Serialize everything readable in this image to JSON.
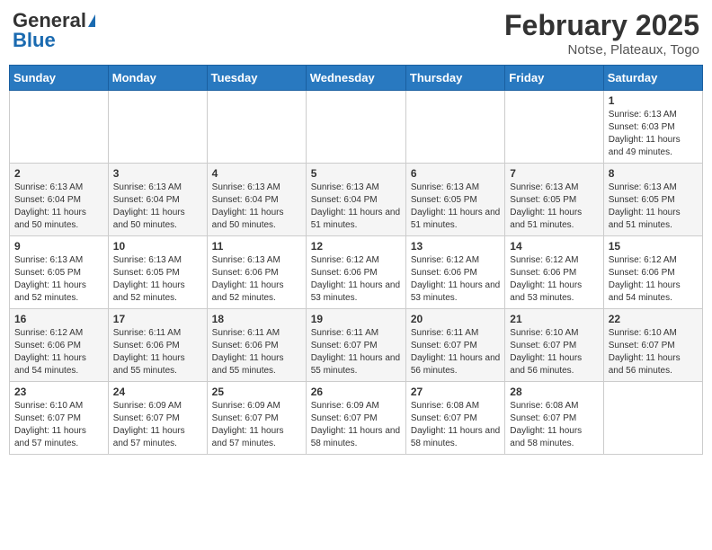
{
  "header": {
    "logo": {
      "line1": "General",
      "line2": "Blue"
    },
    "title": "February 2025",
    "subtitle": "Notse, Plateaux, Togo"
  },
  "days_of_week": [
    "Sunday",
    "Monday",
    "Tuesday",
    "Wednesday",
    "Thursday",
    "Friday",
    "Saturday"
  ],
  "weeks": [
    [
      {
        "day": "",
        "info": ""
      },
      {
        "day": "",
        "info": ""
      },
      {
        "day": "",
        "info": ""
      },
      {
        "day": "",
        "info": ""
      },
      {
        "day": "",
        "info": ""
      },
      {
        "day": "",
        "info": ""
      },
      {
        "day": "1",
        "info": "Sunrise: 6:13 AM\nSunset: 6:03 PM\nDaylight: 11 hours and 49 minutes."
      }
    ],
    [
      {
        "day": "2",
        "info": "Sunrise: 6:13 AM\nSunset: 6:04 PM\nDaylight: 11 hours and 50 minutes."
      },
      {
        "day": "3",
        "info": "Sunrise: 6:13 AM\nSunset: 6:04 PM\nDaylight: 11 hours and 50 minutes."
      },
      {
        "day": "4",
        "info": "Sunrise: 6:13 AM\nSunset: 6:04 PM\nDaylight: 11 hours and 50 minutes."
      },
      {
        "day": "5",
        "info": "Sunrise: 6:13 AM\nSunset: 6:04 PM\nDaylight: 11 hours and 51 minutes."
      },
      {
        "day": "6",
        "info": "Sunrise: 6:13 AM\nSunset: 6:05 PM\nDaylight: 11 hours and 51 minutes."
      },
      {
        "day": "7",
        "info": "Sunrise: 6:13 AM\nSunset: 6:05 PM\nDaylight: 11 hours and 51 minutes."
      },
      {
        "day": "8",
        "info": "Sunrise: 6:13 AM\nSunset: 6:05 PM\nDaylight: 11 hours and 51 minutes."
      }
    ],
    [
      {
        "day": "9",
        "info": "Sunrise: 6:13 AM\nSunset: 6:05 PM\nDaylight: 11 hours and 52 minutes."
      },
      {
        "day": "10",
        "info": "Sunrise: 6:13 AM\nSunset: 6:05 PM\nDaylight: 11 hours and 52 minutes."
      },
      {
        "day": "11",
        "info": "Sunrise: 6:13 AM\nSunset: 6:06 PM\nDaylight: 11 hours and 52 minutes."
      },
      {
        "day": "12",
        "info": "Sunrise: 6:12 AM\nSunset: 6:06 PM\nDaylight: 11 hours and 53 minutes."
      },
      {
        "day": "13",
        "info": "Sunrise: 6:12 AM\nSunset: 6:06 PM\nDaylight: 11 hours and 53 minutes."
      },
      {
        "day": "14",
        "info": "Sunrise: 6:12 AM\nSunset: 6:06 PM\nDaylight: 11 hours and 53 minutes."
      },
      {
        "day": "15",
        "info": "Sunrise: 6:12 AM\nSunset: 6:06 PM\nDaylight: 11 hours and 54 minutes."
      }
    ],
    [
      {
        "day": "16",
        "info": "Sunrise: 6:12 AM\nSunset: 6:06 PM\nDaylight: 11 hours and 54 minutes."
      },
      {
        "day": "17",
        "info": "Sunrise: 6:11 AM\nSunset: 6:06 PM\nDaylight: 11 hours and 55 minutes."
      },
      {
        "day": "18",
        "info": "Sunrise: 6:11 AM\nSunset: 6:06 PM\nDaylight: 11 hours and 55 minutes."
      },
      {
        "day": "19",
        "info": "Sunrise: 6:11 AM\nSunset: 6:07 PM\nDaylight: 11 hours and 55 minutes."
      },
      {
        "day": "20",
        "info": "Sunrise: 6:11 AM\nSunset: 6:07 PM\nDaylight: 11 hours and 56 minutes."
      },
      {
        "day": "21",
        "info": "Sunrise: 6:10 AM\nSunset: 6:07 PM\nDaylight: 11 hours and 56 minutes."
      },
      {
        "day": "22",
        "info": "Sunrise: 6:10 AM\nSunset: 6:07 PM\nDaylight: 11 hours and 56 minutes."
      }
    ],
    [
      {
        "day": "23",
        "info": "Sunrise: 6:10 AM\nSunset: 6:07 PM\nDaylight: 11 hours and 57 minutes."
      },
      {
        "day": "24",
        "info": "Sunrise: 6:09 AM\nSunset: 6:07 PM\nDaylight: 11 hours and 57 minutes."
      },
      {
        "day": "25",
        "info": "Sunrise: 6:09 AM\nSunset: 6:07 PM\nDaylight: 11 hours and 57 minutes."
      },
      {
        "day": "26",
        "info": "Sunrise: 6:09 AM\nSunset: 6:07 PM\nDaylight: 11 hours and 58 minutes."
      },
      {
        "day": "27",
        "info": "Sunrise: 6:08 AM\nSunset: 6:07 PM\nDaylight: 11 hours and 58 minutes."
      },
      {
        "day": "28",
        "info": "Sunrise: 6:08 AM\nSunset: 6:07 PM\nDaylight: 11 hours and 58 minutes."
      },
      {
        "day": "",
        "info": ""
      }
    ]
  ]
}
